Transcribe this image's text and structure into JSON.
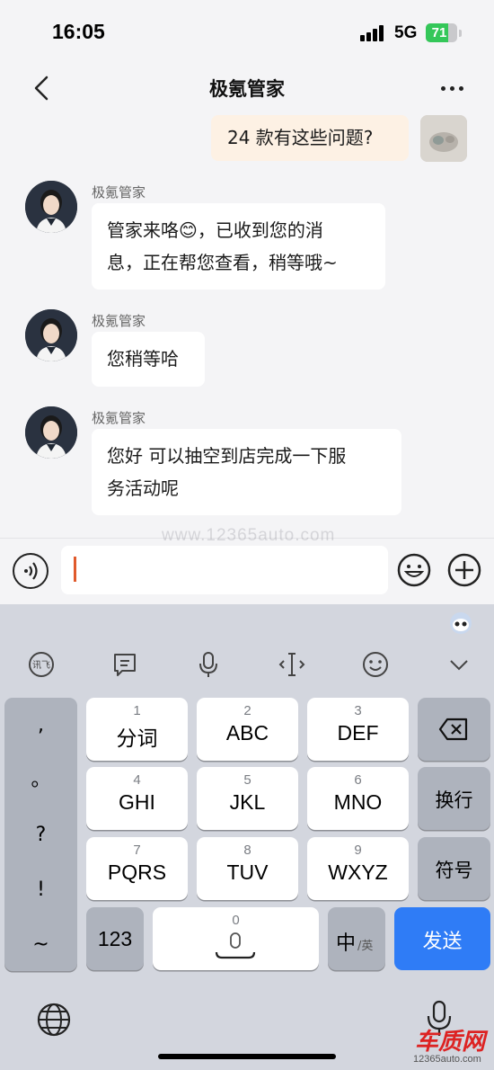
{
  "status_bar": {
    "time": "16:05",
    "network": "5G",
    "battery": "71",
    "battery_level": 0.71
  },
  "nav": {
    "title": "极氪管家"
  },
  "chat": {
    "outgoing": {
      "text": "24 款有这些问题?"
    },
    "messages": [
      {
        "sender": "极氪管家",
        "line1": "管家来咯😊，已收到您的消",
        "line2": "息，正在帮您查看，稍等哦~"
      },
      {
        "sender": "极氪管家",
        "line1": "您稍等哈"
      },
      {
        "sender": "极氪管家",
        "line1": "您好  可以抽空到店完成一下服",
        "line2": "务活动呢"
      }
    ]
  },
  "watermark": "www.12365auto.com",
  "input": {
    "value": ""
  },
  "keyboard": {
    "toolbar": [
      "xunfei-icon",
      "clipboard-icon",
      "mic-icon",
      "cursor-icon",
      "emoji-icon",
      "collapse-icon"
    ],
    "side": [
      ",",
      "。",
      "?",
      "!",
      "~"
    ],
    "keys": [
      {
        "num": "1",
        "label": "分词"
      },
      {
        "num": "2",
        "label": "ABC"
      },
      {
        "num": "3",
        "label": "DEF"
      },
      {
        "num": "4",
        "label": "GHI"
      },
      {
        "num": "5",
        "label": "JKL"
      },
      {
        "num": "6",
        "label": "MNO"
      },
      {
        "num": "7",
        "label": "PQRS"
      },
      {
        "num": "8",
        "label": "TUV"
      },
      {
        "num": "9",
        "label": "WXYZ"
      }
    ],
    "newline": "换行",
    "symbols": "符号",
    "num_switch": "123",
    "space_num": "0",
    "lang_main": "中",
    "lang_sub": "/英",
    "send": "发送"
  },
  "brand": {
    "name": "车质网",
    "url": "12365auto.com"
  },
  "colors": {
    "accent": "#2f7cf6",
    "my_bubble": "#fdf1e4",
    "caret": "#e05a2c"
  }
}
